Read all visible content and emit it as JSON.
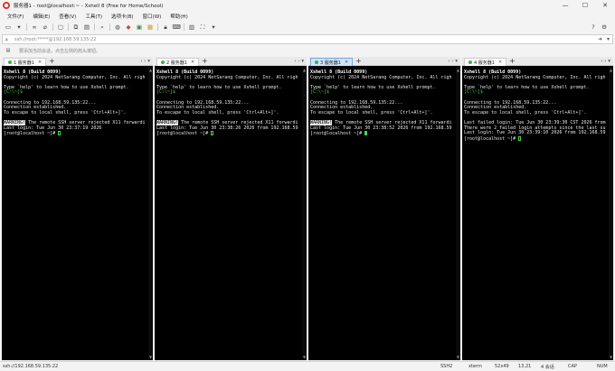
{
  "window": {
    "title": "服务器1 - root@localhost:~ - Xshell 8 (Free for Home/School)",
    "controls": {
      "minimize": "—",
      "maximize": "☐",
      "close": "✕"
    }
  },
  "menu": [
    "文件(F)",
    "编辑(E)",
    "查看(V)",
    "工具(T)",
    "选项卡(B)",
    "窗口(W)",
    "帮助(H)"
  ],
  "toolbar": {
    "icons": [
      "new-session-icon",
      "open-folder-icon",
      "link-icon",
      "unlink-icon",
      "new-tab-icon",
      "copy-icon",
      "paste-icon",
      "find-icon",
      "globe-icon",
      "color-scheme-icon",
      "compose-icon",
      "lock-icon",
      "user-icon",
      "script-icon",
      "fullscreen-icon",
      "more-icon"
    ]
  },
  "address": {
    "text": "ssh://root:*****@192.168.59.135:22"
  },
  "session_hint": "要添加当前会话，点击左侧的箭头按钮。",
  "panes": [
    {
      "tab_label": "1 服务器1",
      "active": false,
      "lines": [
        "Xshell 8 (Build 0099)",
        "Copyright (c) 2024 NetSarang Computer, Inc. All righ",
        "",
        "Type `help' to learn how to use Xshell prompt.",
        "[C:\\~]$",
        "",
        "Connecting to 192.168.59.135:22...",
        "Connection established.",
        "To escape to local shell, press 'Ctrl+Alt+]'.",
        "",
        "WARNING! The remote SSH server rejected X11 forwardi",
        "Last login: Tue Jun 30 23:37:19 2026",
        "[root@localhost ~]# "
      ]
    },
    {
      "tab_label": "2 服务器1",
      "active": false,
      "lines": [
        "Xshell 8 (Build 0099)",
        "Copyright (c) 2024 NetSarang Computer, Inc. All righ",
        "",
        "Type `help' to learn how to use Xshell prompt.",
        "[C:\\~]$",
        "",
        "Connecting to 192.168.59.135:22...",
        "Connection established.",
        "To escape to local shell, press 'Ctrl+Alt+]'.",
        "",
        "WARNING! The remote SSH server rejected X11 forwardi",
        "Last login: Tue Jun 30 23:38:26 2026 from 192.168.59",
        "[root@localhost ~]# "
      ]
    },
    {
      "tab_label": "3 服务器1",
      "active": true,
      "lines": [
        "Xshell 8 (Build 0099)",
        "Copyright (c) 2024 NetSarang Computer, Inc. All righ",
        "",
        "Type `help' to learn how to use Xshell prompt.",
        "[C:\\~]$",
        "",
        "Connecting to 192.168.59.135:22...",
        "Connection established.",
        "To escape to local shell, press 'Ctrl+Alt+]'.",
        "",
        "WARNING! The remote SSH server rejected X11 forwardi",
        "Last login: Tue Jun 30 23:38:52 2026 from 192.168.59",
        "[root@localhost ~]# "
      ]
    },
    {
      "tab_label": "4 服务器1",
      "active": false,
      "lines": [
        "Xshell 8 (Build 0099)",
        "Copyright (c) 2024 NetSarang Computer, Inc. All righ",
        "",
        "Type `help' to learn how to use Xshell prompt.",
        "[C:\\~]$",
        "",
        "Connecting to 192.168.59.135:22...",
        "Connection established.",
        "To escape to local shell, press 'Ctrl+Alt+]'.",
        "",
        "Last failed login: Tue Jun 30 23:39:30 CST 2026 from",
        "There were 2 failed login attempts since the last su",
        "Last login: Tue Jun 30 23:39:10 2026 from 192.168.59",
        "[root@localhost ~]# "
      ]
    }
  ],
  "status": {
    "connection": "ssh://192.168.59.135:22",
    "protocol": "SSH2",
    "term": "xterm",
    "size": "52x49",
    "pos": "13,21",
    "sessions": "4 会话",
    "caps": "CAP",
    "num": "NUM"
  },
  "colors": {
    "terminal_bg": "#000000",
    "terminal_fg": "#e6e6e6",
    "prompt_green": "#35d043",
    "active_tab": "#cfe3fb"
  }
}
